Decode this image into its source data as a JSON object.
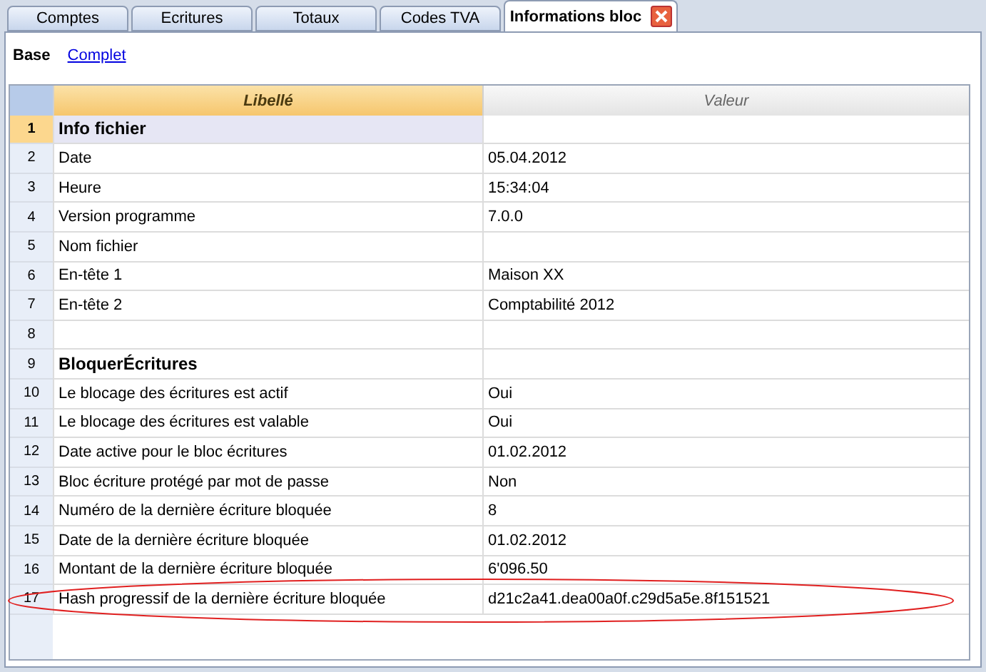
{
  "tabs": [
    {
      "label": "Comptes",
      "selected": false
    },
    {
      "label": "Ecritures",
      "selected": false
    },
    {
      "label": "Totaux",
      "selected": false
    },
    {
      "label": "Codes TVA",
      "selected": false
    },
    {
      "label": "Informations bloc",
      "selected": true,
      "closable": true
    }
  ],
  "views": [
    {
      "label": "Base",
      "selected": true
    },
    {
      "label": "Complet",
      "selected": false
    }
  ],
  "table": {
    "columns": [
      "Libellé",
      "Valeur"
    ],
    "rows": [
      {
        "number": "1",
        "label": "Info fichier",
        "value": "",
        "kind": "section",
        "selected": true
      },
      {
        "number": "2",
        "label": "Date",
        "value": "05.04.2012",
        "kind": "item",
        "selected": false
      },
      {
        "number": "3",
        "label": "Heure",
        "value": "15:34:04",
        "kind": "item",
        "selected": false
      },
      {
        "number": "4",
        "label": "Version programme",
        "value": "7.0.0",
        "kind": "item",
        "selected": false
      },
      {
        "number": "5",
        "label": "Nom fichier",
        "value": "",
        "kind": "item",
        "selected": false
      },
      {
        "number": "6",
        "label": "En-tête 1",
        "value": "Maison XX",
        "kind": "item",
        "selected": false
      },
      {
        "number": "7",
        "label": "En-tête 2",
        "value": "Comptabilité 2012",
        "kind": "item",
        "selected": false
      },
      {
        "number": "8",
        "label": "",
        "value": "",
        "kind": "item",
        "selected": false
      },
      {
        "number": "9",
        "label": "BloquerÉcritures",
        "value": "",
        "kind": "section",
        "selected": false
      },
      {
        "number": "10",
        "label": "Le blocage des écritures est actif",
        "value": "Oui",
        "kind": "item",
        "selected": false
      },
      {
        "number": "11",
        "label": "Le blocage des écritures est valable",
        "value": "Oui",
        "kind": "item",
        "selected": false
      },
      {
        "number": "12",
        "label": "Date active pour le bloc écritures",
        "value": "01.02.2012",
        "kind": "item",
        "selected": false
      },
      {
        "number": "13",
        "label": "Bloc écriture protégé par mot de passe",
        "value": "Non",
        "kind": "item",
        "selected": false
      },
      {
        "number": "14",
        "label": "Numéro de la dernière écriture bloquée",
        "value": "8",
        "kind": "item",
        "selected": false
      },
      {
        "number": "15",
        "label": "Date de la dernière écriture bloquée",
        "value": "01.02.2012",
        "kind": "item",
        "selected": false
      },
      {
        "number": "16",
        "label": "Montant de la dernière écriture bloquée",
        "value": "6'096.50",
        "kind": "item",
        "selected": false
      },
      {
        "number": "17",
        "label": "Hash progressif de la dernière écriture bloquée",
        "value": "d21c2a41.dea00a0f.c29d5a5e.8f151521",
        "kind": "item",
        "selected": false,
        "circled": true
      }
    ]
  }
}
